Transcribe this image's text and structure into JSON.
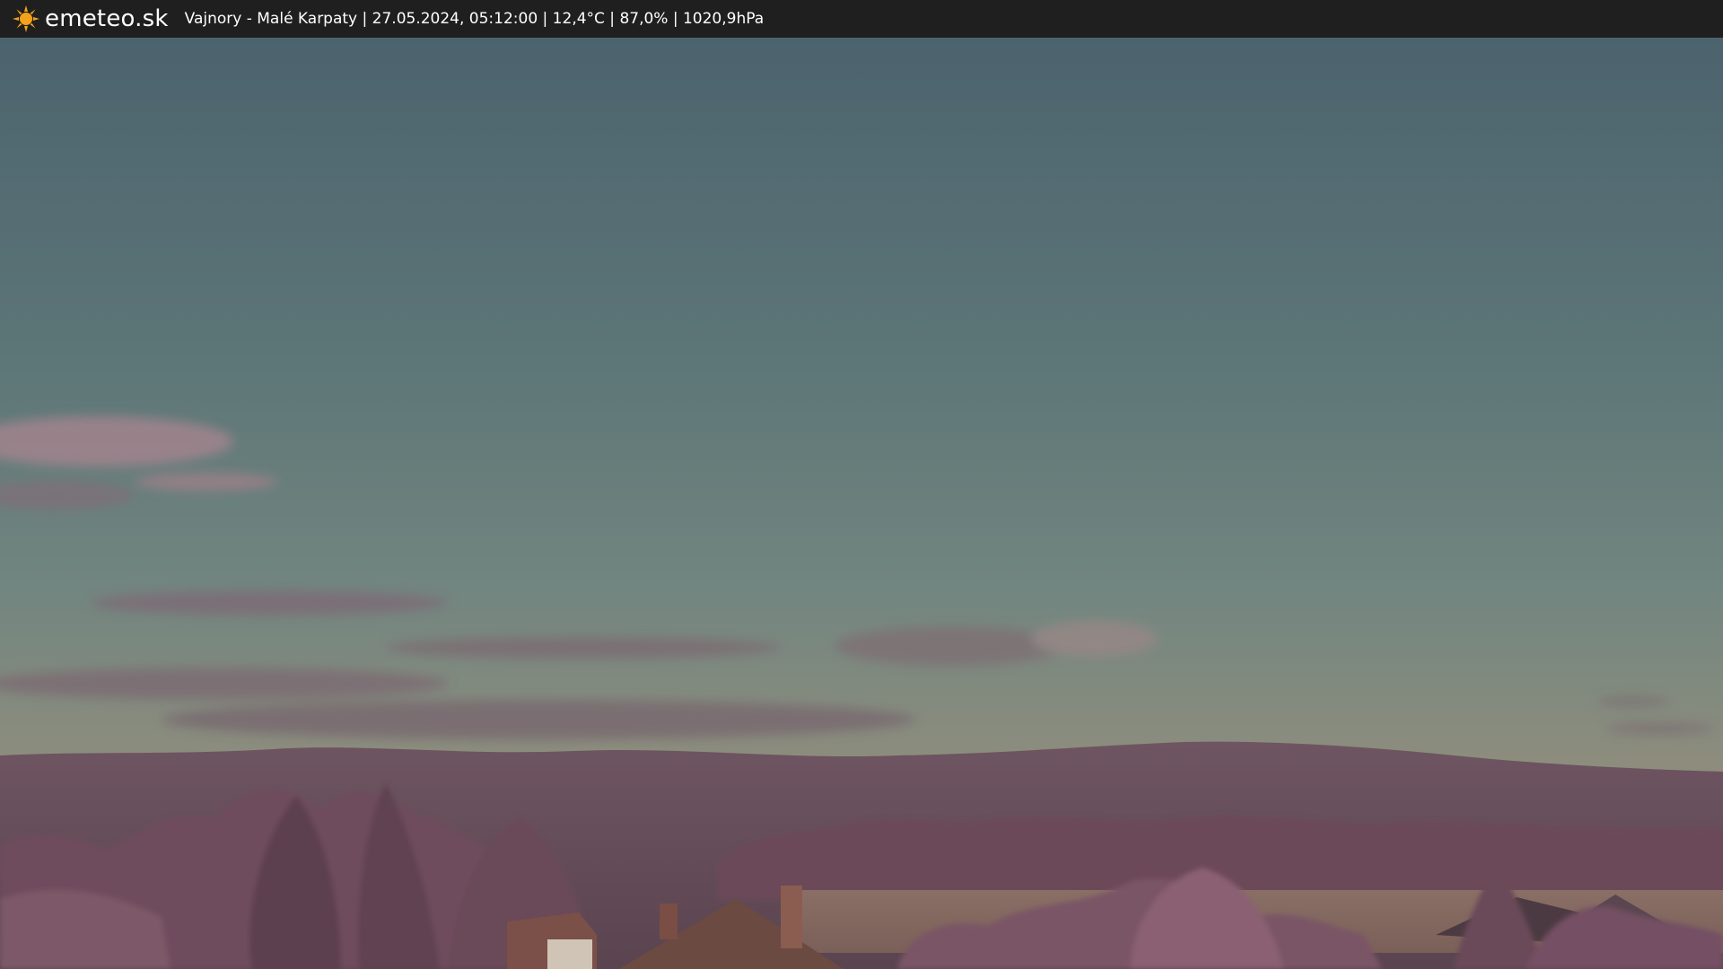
{
  "header": {
    "brand": "emeteo.sk",
    "logo_icon": "sun-icon",
    "caption": "Vajnory - Malé Karpaty | 27.05.2024, 05:12:00 | 12,4°C | 87,0% | 1020,9hPa"
  },
  "colors": {
    "bar": "#1f1f1f",
    "sun": "#f4a21b",
    "sky_top": "#4e6570",
    "sky_mid": "#667f80",
    "sky_low": "#8f8f7f",
    "hills": "#6a4f5c",
    "trees": "#7a5565"
  }
}
